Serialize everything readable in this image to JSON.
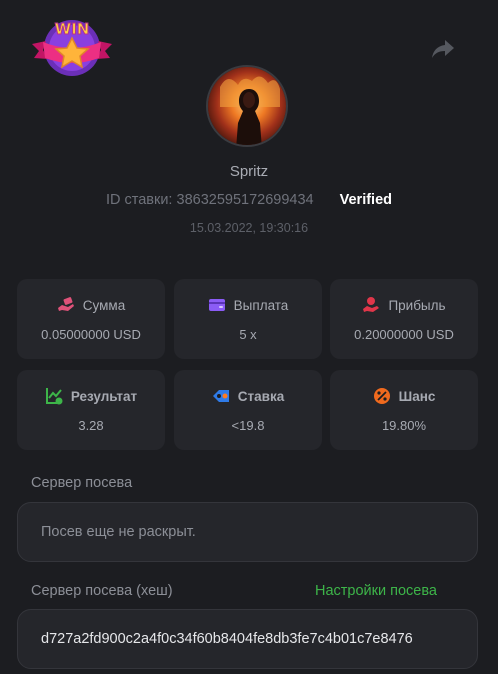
{
  "header": {
    "logo_text": "WIN",
    "share_icon": "share-icon"
  },
  "profile": {
    "username": "Spritz",
    "bet_id_label": "ID ставки:",
    "bet_id": "38632595172699434",
    "verified": "Verified",
    "date": "15.03.2022, 19:30:16"
  },
  "stats": [
    {
      "label": "Сумма",
      "value": "0.05000000 USD",
      "icon": "hand-money-icon",
      "color": "#e0527a"
    },
    {
      "label": "Выплата",
      "value": "5 x",
      "icon": "wallet-icon",
      "color": "#8b5cf6"
    },
    {
      "label": "Прибыль",
      "value": "0.20000000 USD",
      "icon": "hand-coins-icon",
      "color": "#e0364a"
    },
    {
      "label": "Результат",
      "value": "3.28",
      "icon": "chart-check-icon",
      "color": "#3db549"
    },
    {
      "label": "Ставка",
      "value": "<19.8",
      "icon": "tag-icon",
      "color": "#2f7be8"
    },
    {
      "label": "Шанс",
      "value": "19.80%",
      "icon": "percent-icon",
      "color": "#f06a1e"
    }
  ],
  "server_seed": {
    "label": "Сервер посева",
    "value": "Посев еще не раскрыт."
  },
  "server_seed_hash": {
    "label": "Сервер посева (хеш)",
    "settings_link": "Настройки посева",
    "value": "d727a2fd900c2a4f0c34f60b8404fe8db3fe7c4b01c7e8476"
  }
}
